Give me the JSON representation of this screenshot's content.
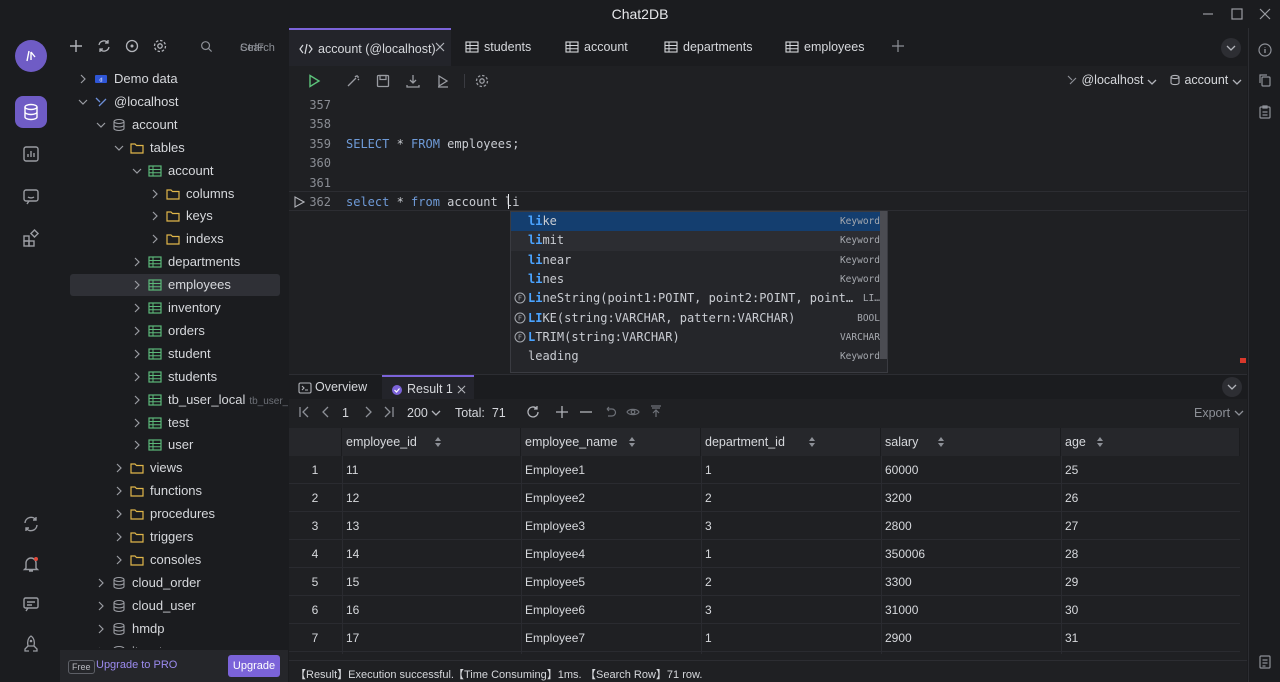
{
  "window": {
    "title": "Chat2DB"
  },
  "sidebar": {
    "search_label": "Search",
    "search_shortcut": "CtrlF",
    "tree": [
      {
        "label": "Demo data",
        "level": 0,
        "kind": "demo",
        "open": false
      },
      {
        "label": "@localhost",
        "level": 0,
        "kind": "conn",
        "open": true
      },
      {
        "label": "account",
        "level": 1,
        "kind": "db",
        "open": true
      },
      {
        "label": "tables",
        "level": 2,
        "kind": "folder",
        "open": true
      },
      {
        "label": "account",
        "level": 3,
        "kind": "table",
        "open": true
      },
      {
        "label": "columns",
        "level": 4,
        "kind": "folder",
        "open": false
      },
      {
        "label": "keys",
        "level": 4,
        "kind": "folder",
        "open": false
      },
      {
        "label": "indexs",
        "level": 4,
        "kind": "folder",
        "open": false
      },
      {
        "label": "departments",
        "level": 3,
        "kind": "table",
        "open": false
      },
      {
        "label": "employees",
        "level": 3,
        "kind": "table",
        "open": false,
        "selected": true
      },
      {
        "label": "inventory",
        "level": 3,
        "kind": "table",
        "open": false
      },
      {
        "label": "orders",
        "level": 3,
        "kind": "table",
        "open": false
      },
      {
        "label": "student",
        "level": 3,
        "kind": "table",
        "open": false
      },
      {
        "label": "students",
        "level": 3,
        "kind": "table",
        "open": false
      },
      {
        "label": "tb_user_local",
        "sub": "tb_user_loca",
        "level": 3,
        "kind": "table",
        "open": false
      },
      {
        "label": "test",
        "level": 3,
        "kind": "table",
        "open": false
      },
      {
        "label": "user",
        "level": 3,
        "kind": "table",
        "open": false
      },
      {
        "label": "views",
        "level": 2,
        "kind": "folder",
        "open": false
      },
      {
        "label": "functions",
        "level": 2,
        "kind": "folder",
        "open": false
      },
      {
        "label": "procedures",
        "level": 2,
        "kind": "folder",
        "open": false
      },
      {
        "label": "triggers",
        "level": 2,
        "kind": "folder",
        "open": false
      },
      {
        "label": "consoles",
        "level": 2,
        "kind": "folder",
        "open": false
      },
      {
        "label": "cloud_order",
        "level": 1,
        "kind": "db",
        "open": false
      },
      {
        "label": "cloud_user",
        "level": 1,
        "kind": "db",
        "open": false
      },
      {
        "label": "hmdp",
        "level": 1,
        "kind": "db",
        "open": false
      },
      {
        "label": "itcast",
        "level": 1,
        "kind": "db",
        "open": false
      }
    ],
    "free_badge": "Free",
    "upgrade_text": "Upgrade to PRO",
    "upgrade_button": "Upgrade"
  },
  "tabs": [
    {
      "label": "account (@localhost)",
      "icon": "code-icon",
      "active": true
    },
    {
      "label": "students",
      "icon": "table-icon"
    },
    {
      "label": "account",
      "icon": "table-icon"
    },
    {
      "label": "departments",
      "icon": "table-icon"
    },
    {
      "label": "employees",
      "icon": "table-icon"
    }
  ],
  "editor_toolbar": {
    "connection": "@localhost",
    "database": "account"
  },
  "editor": {
    "lines": [
      {
        "n": "357",
        "code": ""
      },
      {
        "n": "358",
        "code": ""
      },
      {
        "n": "359",
        "kw1": "SELECT",
        "mid": " * ",
        "kw2": "FROM",
        "tail": " employees;"
      },
      {
        "n": "360",
        "code": ""
      },
      {
        "n": "361",
        "code": ""
      },
      {
        "n": "362",
        "kw1": "select",
        "mid": " * ",
        "kw2": "from",
        "tail": " account li"
      }
    ]
  },
  "autocomplete": [
    {
      "match": "li",
      "rest": "ke",
      "type": "Keyword",
      "fn": false
    },
    {
      "match": "li",
      "rest": "mit",
      "type": "Keyword",
      "fn": false
    },
    {
      "match": "li",
      "rest": "near",
      "type": "Keyword",
      "fn": false
    },
    {
      "match": "li",
      "rest": "nes",
      "type": "Keyword",
      "fn": false
    },
    {
      "match": "Li",
      "rest": "neString(point1:POINT, point2:POINT, point…",
      "type": "LI…",
      "fn": true
    },
    {
      "match": "LI",
      "rest": "KE(string:VARCHAR, pattern:VARCHAR)",
      "type": "BOOL",
      "fn": true
    },
    {
      "match": "L",
      "rest": "TRIM(string:VARCHAR)",
      "type": "VARCHAR",
      "fn": true
    },
    {
      "match": "",
      "rest": "leading",
      "type": "Keyword",
      "fn": false
    }
  ],
  "result": {
    "overview_tab": "Overview",
    "result_tab": "Result 1",
    "page": "1",
    "page_size": "200",
    "total": "Total:  71",
    "export": "Export",
    "columns": [
      "employee_id",
      "employee_name",
      "department_id",
      "salary",
      "age"
    ],
    "rows": [
      [
        "1",
        "11",
        "Employee1",
        "1",
        "60000",
        "25"
      ],
      [
        "2",
        "12",
        "Employee2",
        "2",
        "3200",
        "26"
      ],
      [
        "3",
        "13",
        "Employee3",
        "3",
        "2800",
        "27"
      ],
      [
        "4",
        "14",
        "Employee4",
        "1",
        "350006",
        "28"
      ],
      [
        "5",
        "15",
        "Employee5",
        "2",
        "3300",
        "29"
      ],
      [
        "6",
        "16",
        "Employee6",
        "3",
        "31000",
        "30"
      ],
      [
        "7",
        "17",
        "Employee7",
        "1",
        "2900",
        "31"
      ]
    ]
  },
  "status": {
    "result": "【Result】Execution successful.",
    "time": "【Time Consuming】1ms.",
    "rows": "【Search Row】71 row."
  },
  "colors": {
    "accent": "#7b63d9",
    "keyword": "#6f9bd8",
    "table_icon": "#5cb87a",
    "folder_icon": "#e0b64a"
  }
}
